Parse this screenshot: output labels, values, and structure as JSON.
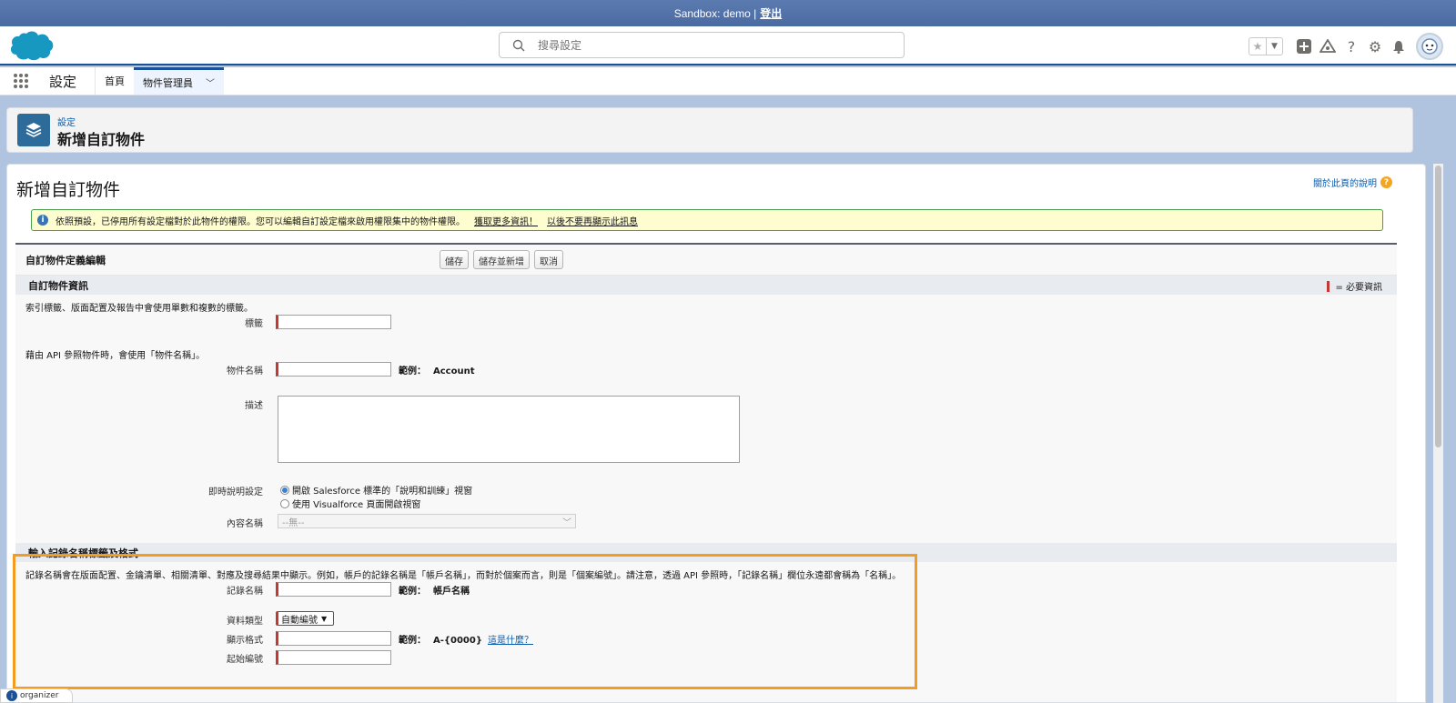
{
  "sandbox": {
    "text": "Sandbox: demo | ",
    "logout": "登出"
  },
  "search": {
    "placeholder": "搜尋設定"
  },
  "nav": {
    "app_name": "設定",
    "tabs": [
      {
        "label": "首頁"
      },
      {
        "label": "物件管理員"
      }
    ]
  },
  "page_header": {
    "breadcrumb": "設定",
    "title": "新增自訂物件"
  },
  "main": {
    "title": "新增自訂物件",
    "help_link": "關於此頁的說明",
    "banner": {
      "text": "依照預設，已停用所有設定檔對於此物件的權限。您可以編輯自訂設定檔來啟用權限集中的物件權限。",
      "link1": "獲取更多資訊！",
      "link2": "以後不要再顯示此訊息"
    }
  },
  "form": {
    "title": "自訂物件定義編輯",
    "buttons": {
      "save": "儲存",
      "save_new": "儲存並新增",
      "cancel": "取消"
    },
    "section1": {
      "title": "自訂物件資訊",
      "required_note": "= 必要資訊",
      "note1": "索引標籤、版面配置及報告中會使用單數和複數的標籤。",
      "label_field": "標籤",
      "note2": "藉由 API 參照物件時，會使用「物件名稱」。",
      "object_name": "物件名稱",
      "object_example_label": "範例：",
      "object_example_value": "Account",
      "description": "描述",
      "help_setting": "即時說明設定",
      "radio1": "開啟 Salesforce 標準的「說明和訓練」視窗",
      "radio2": "使用 Visualforce 頁面開啟視窗",
      "content_name": "內容名稱",
      "content_placeholder": "--無--"
    },
    "section2": {
      "title": "輸入記錄名稱標籤及格式",
      "note": "記錄名稱會在版面配置、金鑰清單、相關清單、對應及搜尋結果中顯示。例如，帳戶的記錄名稱是「帳戶名稱」，而對於個案而言，則是「個案編號」。請注意，透過 API 參照時，「記錄名稱」欄位永遠都會稱為「名稱」。",
      "record_name": "記錄名稱",
      "record_example_label": "範例：",
      "record_example_value": "帳戶名稱",
      "data_type": "資料類型",
      "data_type_value": "自動編號",
      "display_format": "顯示格式",
      "display_example_label": "範例：",
      "display_example_value": "A-{0000}",
      "what_is_this": "這是什麼？",
      "start_number": "起始編號"
    }
  },
  "organizer": "organizer",
  "colors": {
    "highlight": "#f29d22",
    "brand": "#1b5297",
    "required": "#c23934"
  }
}
